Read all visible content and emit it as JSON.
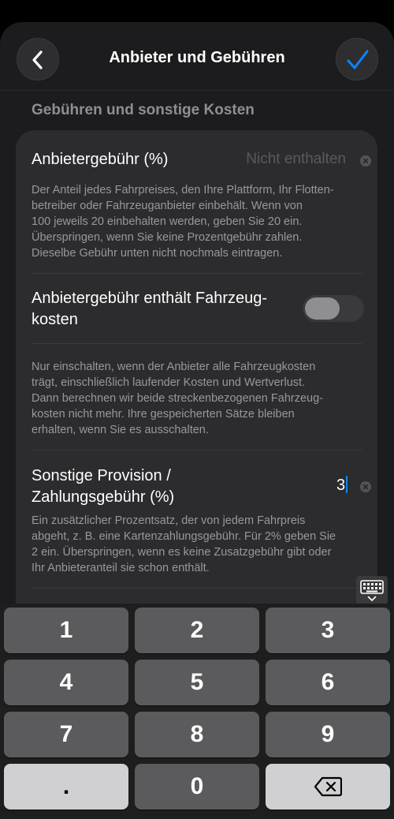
{
  "header": {
    "title": "Anbieter und Gebühren",
    "back_icon": "chevron-left-icon",
    "confirm_icon": "checkmark-icon",
    "accent_color": "#0a84ff"
  },
  "section_title": "Gebühren und sonstige Kosten",
  "fields": {
    "provider_fee": {
      "label": "Anbietergebühr (%)",
      "placeholder": "Nicht enthalten",
      "desc_lines": [
        "Der Anteil jedes Fahrpreises, den Ihre Plattform, Ihr Flotten-",
        "betreiber oder Fahrzeuganbieter einbehält. Wenn von",
        "100 jeweils 20 einbehalten werden, geben Sie 20 ein.",
        "Überspringen, wenn Sie keine Prozentgebühr zahlen.",
        "Dieselbe Gebühr unten nicht nochmals eintragen."
      ]
    },
    "includes_vehicle_costs": {
      "label_lines": [
        "Anbietergebühr enthält Fahrzeug-",
        "kosten"
      ],
      "enabled": false,
      "desc_lines": [
        "Nur einschalten, wenn der Anbieter alle Fahrzeugkosten",
        "trägt, einschließlich laufender Kosten und Wertverlust.",
        "Dann berechnen wir beide streckenbezogenen Fahrzeug-",
        "kosten nicht mehr. Ihre gespeicherten Sätze bleiben",
        "erhalten, wenn Sie es ausschalten."
      ]
    },
    "other_commission": {
      "label_lines": [
        "Sonstige Provision /",
        "Zahlungsgebühr (%)"
      ],
      "value": "3",
      "desc_lines": [
        "Ein zusätzlicher Prozentsatz, der von jedem Fahrpreis",
        "abgeht, z. B. eine Kartenzahlungsgebühr. Für 2% geben Sie",
        "2 ein. Überspringen, wenn es keine Zusatzgebühr gibt oder",
        "Ihr Anbieteranteil sie schon enthält."
      ]
    }
  },
  "keyboard": {
    "keys": [
      "1",
      "2",
      "3",
      "4",
      "5",
      "6",
      "7",
      "8",
      "9",
      ".",
      "0"
    ],
    "delete_icon": "backspace-icon",
    "dismiss_icon": "keyboard-dismiss-icon"
  }
}
